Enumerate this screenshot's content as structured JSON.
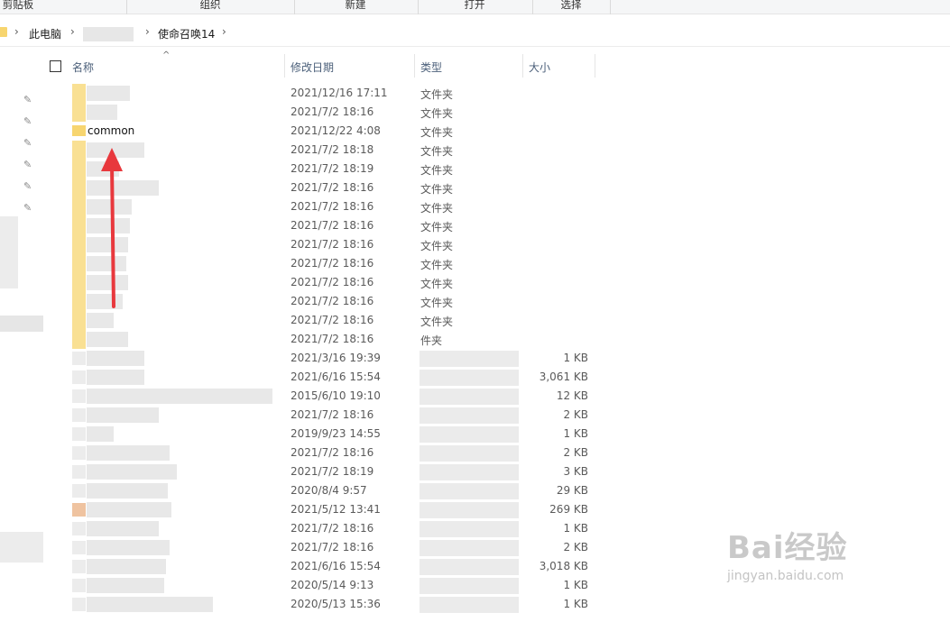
{
  "ribbon": {
    "groups": [
      "剪贴板",
      "组织",
      "新建",
      "打开",
      "选择"
    ]
  },
  "address": {
    "crumbs": [
      "此电脑",
      "使命召唤14"
    ]
  },
  "columns": {
    "name": "名称",
    "modified": "修改日期",
    "type": "类型",
    "size": "大小"
  },
  "rows": [
    {
      "name": "",
      "date": "2021/12/16 17:11",
      "type": "文件夹",
      "size": "",
      "kind": "folder"
    },
    {
      "name": "",
      "date": "2021/7/2 18:16",
      "type": "文件夹",
      "size": "",
      "kind": "folder"
    },
    {
      "name": "common",
      "date": "2021/12/22 4:08",
      "type": "文件夹",
      "size": "",
      "kind": "folder"
    },
    {
      "name": "",
      "date": "2021/7/2 18:18",
      "type": "文件夹",
      "size": "",
      "kind": "folder"
    },
    {
      "name": "",
      "date": "2021/7/2 18:19",
      "type": "文件夹",
      "size": "",
      "kind": "folder"
    },
    {
      "name": "",
      "date": "2021/7/2 18:16",
      "type": "文件夹",
      "size": "",
      "kind": "folder"
    },
    {
      "name": "",
      "date": "2021/7/2 18:16",
      "type": "文件夹",
      "size": "",
      "kind": "folder"
    },
    {
      "name": "",
      "date": "2021/7/2 18:16",
      "type": "文件夹",
      "size": "",
      "kind": "folder"
    },
    {
      "name": "",
      "date": "2021/7/2 18:16",
      "type": "文件夹",
      "size": "",
      "kind": "folder"
    },
    {
      "name": "",
      "date": "2021/7/2 18:16",
      "type": "文件夹",
      "size": "",
      "kind": "folder"
    },
    {
      "name": "",
      "date": "2021/7/2 18:16",
      "type": "文件夹",
      "size": "",
      "kind": "folder"
    },
    {
      "name": "",
      "date": "2021/7/2 18:16",
      "type": "文件夹",
      "size": "",
      "kind": "folder"
    },
    {
      "name": "",
      "date": "2021/7/2 18:16",
      "type": "文件夹",
      "size": "",
      "kind": "folder"
    },
    {
      "name": "",
      "date": "2021/7/2 18:16",
      "type": "件夹",
      "size": "",
      "kind": "folder"
    },
    {
      "name": "",
      "date": "2021/3/16 19:39",
      "type": "",
      "size": "1 KB",
      "kind": "file"
    },
    {
      "name": "",
      "date": "2021/6/16 15:54",
      "type": "",
      "size": "3,061 KB",
      "kind": "file"
    },
    {
      "name": "",
      "date": "2015/6/10 19:10",
      "type": "",
      "size": "12 KB",
      "kind": "file"
    },
    {
      "name": "",
      "date": "2021/7/2 18:16",
      "type": "",
      "size": "2 KB",
      "kind": "file"
    },
    {
      "name": "",
      "date": "2019/9/23 14:55",
      "type": "",
      "size": "1 KB",
      "kind": "file"
    },
    {
      "name": "",
      "date": "2021/7/2 18:16",
      "type": "",
      "size": "2 KB",
      "kind": "file"
    },
    {
      "name": "",
      "date": "2021/7/2 18:19",
      "type": "",
      "size": "3 KB",
      "kind": "file"
    },
    {
      "name": "",
      "date": "2020/8/4 9:57",
      "type": "",
      "size": "29 KB",
      "kind": "file"
    },
    {
      "name": "",
      "date": "2021/5/12 13:41",
      "type": "",
      "size": "269 KB",
      "kind": "file-orange"
    },
    {
      "name": "",
      "date": "2021/7/2 18:16",
      "type": "",
      "size": "1 KB",
      "kind": "file"
    },
    {
      "name": "",
      "date": "2021/7/2 18:16",
      "type": "",
      "size": "2 KB",
      "kind": "file"
    },
    {
      "name": "",
      "date": "2021/6/16 15:54",
      "type": "",
      "size": "3,018 KB",
      "kind": "file"
    },
    {
      "name": "",
      "date": "2020/5/14 9:13",
      "type": "",
      "size": "1 KB",
      "kind": "file"
    },
    {
      "name": "",
      "date": "2020/5/13 15:36",
      "type": "",
      "size": "1 KB",
      "kind": "file"
    }
  ],
  "watermark": {
    "brand": "Bai经验",
    "url": "jingyan.baidu.com"
  },
  "colors": {
    "folder": "#f7d56f",
    "annotation_arrow": "#e8383d",
    "header_text": "#4c607a"
  }
}
